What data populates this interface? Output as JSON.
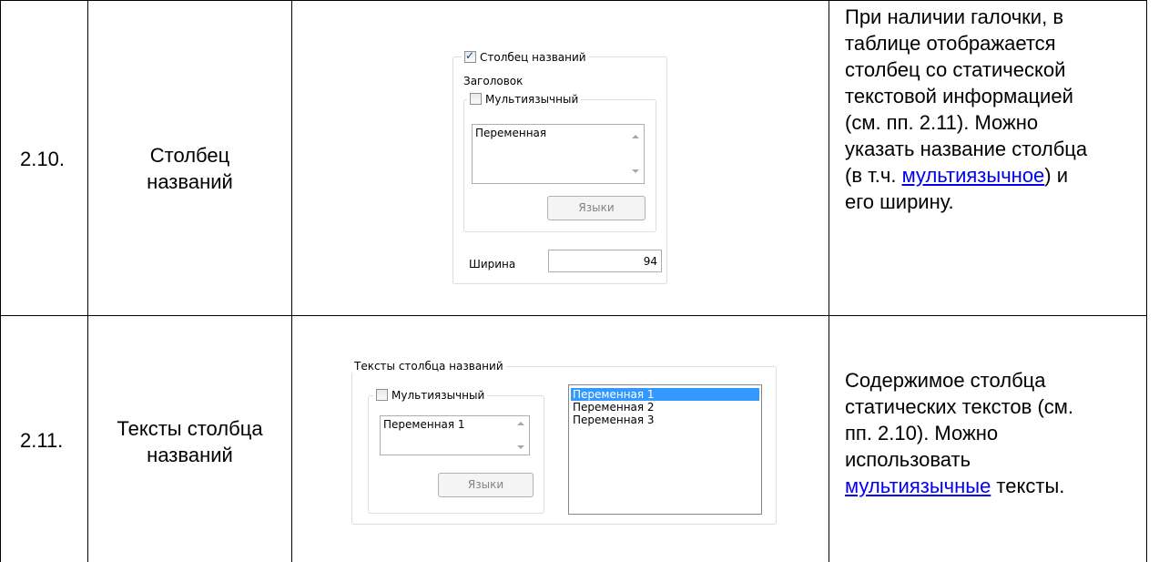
{
  "rows": [
    {
      "number": "2.10.",
      "name_line1": "Столбец",
      "name_line2": "названий",
      "description_lines": [
        "При наличии галочки, в",
        "таблице отображается",
        "столбец со статической",
        "текстовой информацией",
        "(см. пп. 2.11). Можно",
        "указать название столбца"
      ],
      "desc_pre_link": "(в т.ч. ",
      "desc_link": "мультиязычное",
      "desc_post_link": ") и",
      "desc_last": "его ширину.",
      "panel": {
        "column_checkbox_label": "Столбец названий",
        "column_checkbox_checked": true,
        "header_label": "Заголовок",
        "multilang_label": "Мультиязычный",
        "text_value": "Переменная",
        "languages_button": "Языки",
        "width_label": "Ширина",
        "width_value": "94"
      }
    },
    {
      "number": "2.11.",
      "name_line1": "Тексты столбца",
      "name_line2": "названий",
      "description_lines": [
        "Содержимое столбца",
        "статических текстов (см.",
        "пп. 2.10). Можно",
        "использовать"
      ],
      "desc_link": "мультиязычные",
      "desc_post_link": " тексты.",
      "panel": {
        "group_title": "Тексты столбца названий",
        "multilang_label": "Мультиязычный",
        "text_value": "Переменная 1",
        "languages_button": "Языки",
        "list_items": [
          "Переменная 1",
          "Переменная 2",
          "Переменная 3"
        ],
        "selected_item": "Переменная 1"
      }
    }
  ]
}
